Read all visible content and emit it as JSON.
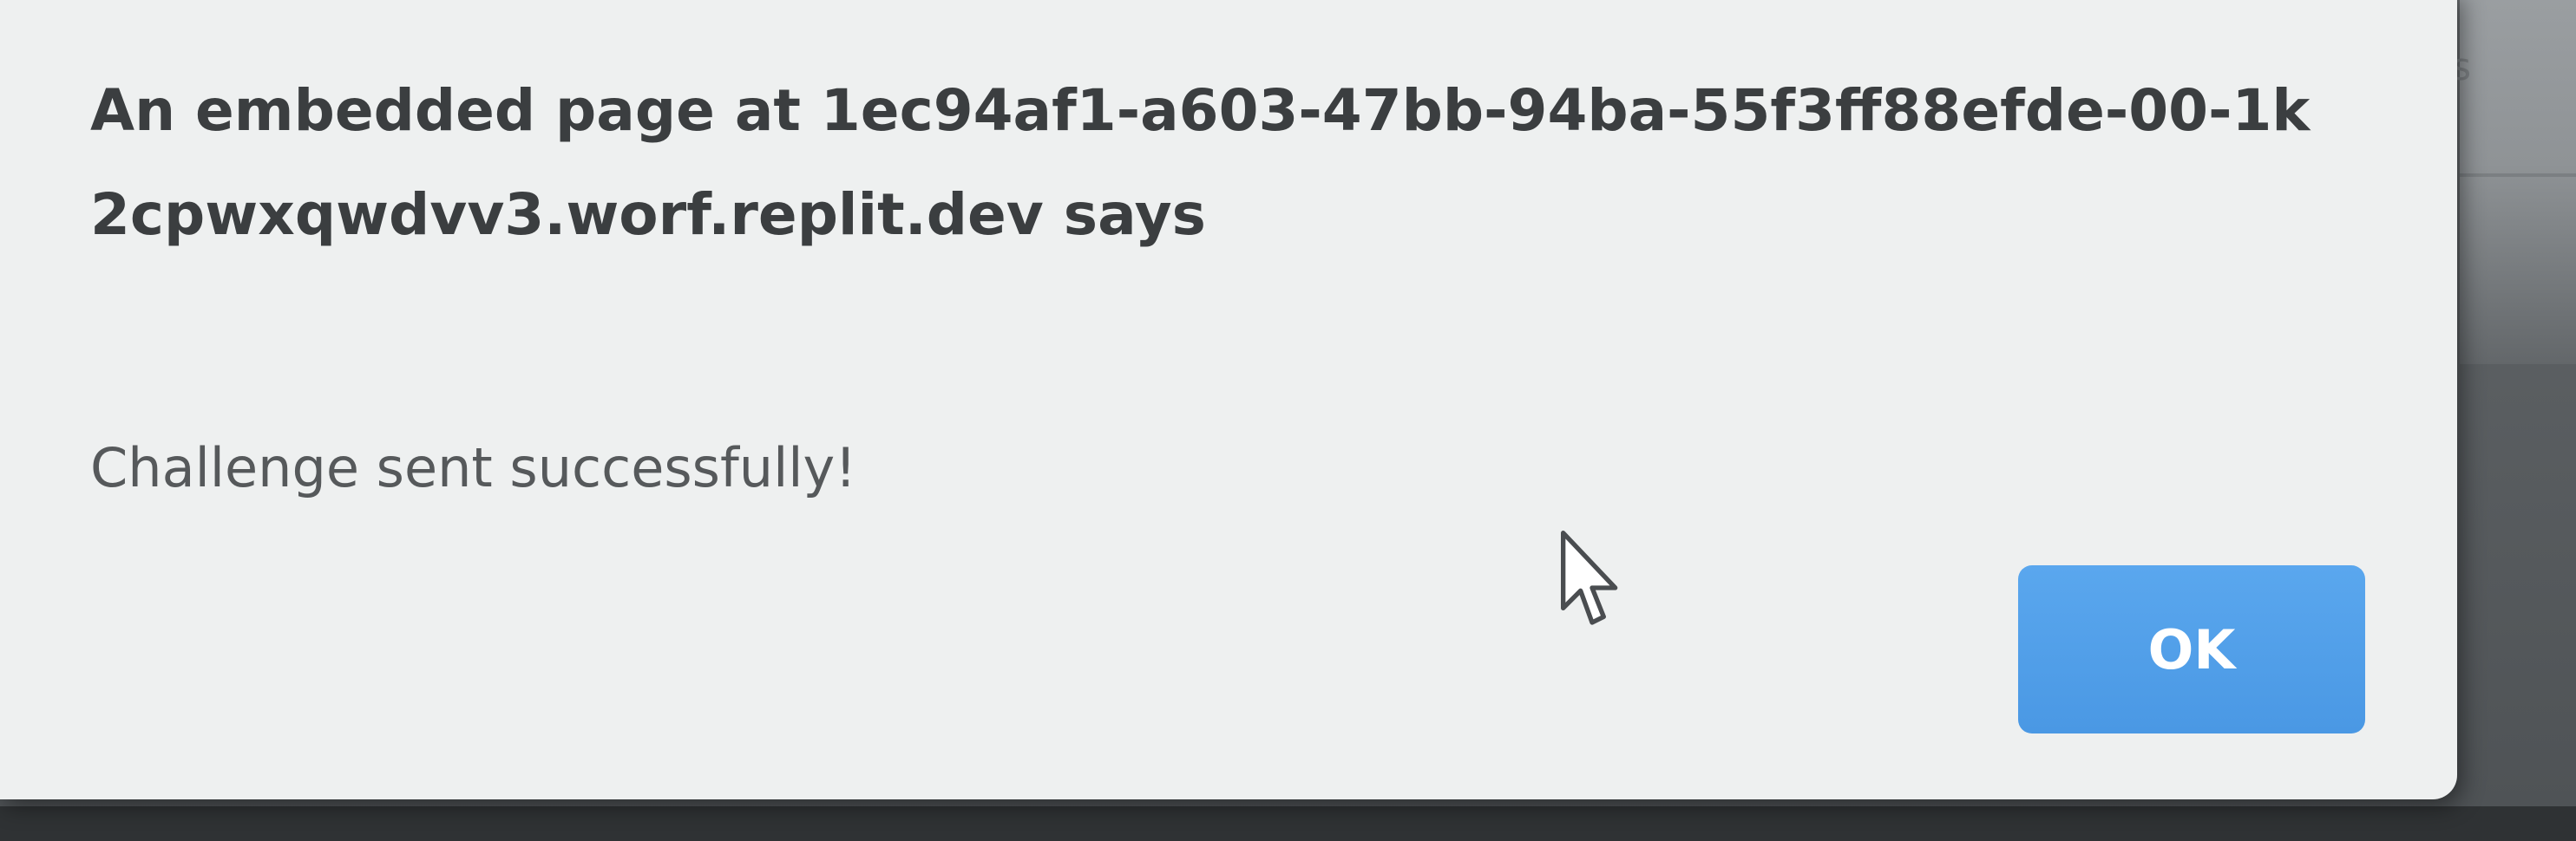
{
  "dialog": {
    "heading": "An embedded page at 1ec94af1-a603-47bb-94ba-55f3ff88efde-00-1k2cpwxqwdvv3.worf.replit.dev says",
    "message": "Challenge sent successfully!",
    "ok_label": "OK"
  },
  "background": {
    "fragment_text": "ts"
  },
  "icons": {
    "cursor": "mouse-pointer-icon"
  },
  "colors": {
    "button": "#4a98e4",
    "dialog_bg": "#eef0f0",
    "heading_text": "#3b3e40"
  }
}
